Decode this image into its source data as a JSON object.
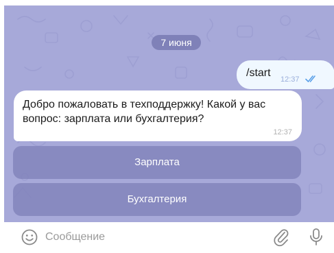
{
  "date_label": "7 июня",
  "outgoing_message": {
    "text": "/start",
    "time": "12:37",
    "status_icon": "double-check-icon"
  },
  "incoming_message": {
    "text": "Добро пожаловать в техподдержку! Какой у вас вопрос: зарплата или бухгалтерия?",
    "time": "12:37"
  },
  "keyboard_buttons": [
    "Зарплата",
    "Бухгалтерия"
  ],
  "input_bar": {
    "placeholder": "Сообщение",
    "left_icon": "emoji-icon",
    "right_icons": [
      "paperclip-icon",
      "microphone-icon"
    ]
  },
  "colors": {
    "wallpaper": "#a7a9d9",
    "outgoing_bubble": "#f0f8ff",
    "incoming_bubble": "#ffffff",
    "keyboard_button": "#8183bb",
    "check_marks": "#5aa0e8"
  }
}
